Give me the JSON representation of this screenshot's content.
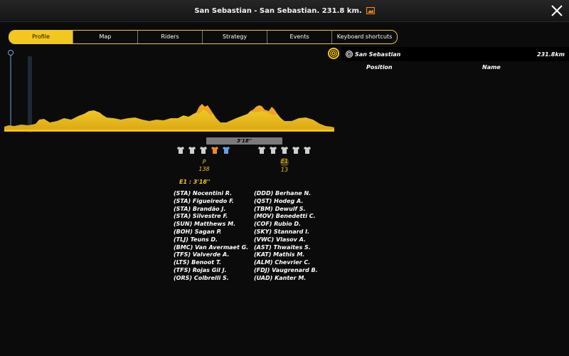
{
  "window": {
    "title": "San Sebastian - San Sebastian. 231.8 km."
  },
  "tabs": [
    {
      "label": "Profile",
      "active": true
    },
    {
      "label": "Map"
    },
    {
      "label": "Riders"
    },
    {
      "label": "Strategy"
    },
    {
      "label": "Events"
    },
    {
      "label": "Keyboard shortcuts"
    }
  ],
  "gap": {
    "bar_time": "3'18''",
    "summary": "E1 : 3'18''"
  },
  "peloton_group": {
    "label": "P",
    "count": "138"
  },
  "escape_group": {
    "label": "E1",
    "count": "13"
  },
  "jersey_groups": {
    "peloton": [
      "grey",
      "grey",
      "grey",
      "orange",
      "blue"
    ],
    "escape": [
      "grey",
      "grey",
      "grey",
      "grey",
      "grey"
    ]
  },
  "riders_left": [
    "(STA) Nocentini R.",
    "(STA) Figueiredo F.",
    "(STA) Brandão J.",
    "(STA) Silvestre F.",
    "(SUN) Matthews M.",
    "(BOH) Sagan P.",
    "(TLJ) Teuns D.",
    "(BMC) Van Avermaet G.",
    "(TFS) Valverde A.",
    "(LTS) Benoot T.",
    "(TFS) Rojas Gil J.",
    "(ORS) Colbrelli S."
  ],
  "riders_right": [
    "(DDD) Berhane N.",
    "(QST) Hodeg A.",
    "(TBM) Dewulf S.",
    "(MOV) Benedetti C.",
    "(COF) Rubio D.",
    "(SKY) Stannard I.",
    "(VWC) Vlasov A.",
    "(AST) Thwaites S.",
    "(KAT) Mathis M.",
    "(ALM) Chevrier C.",
    "(FDJ) Vaugrenard B.",
    "(UAD) Kanter M."
  ],
  "right_panel": {
    "race_name": "San Sebastian",
    "distance": "231.8km",
    "col_position": "Position",
    "col_name": "Name"
  },
  "colors": {
    "accent": "#f3c71d",
    "profile_fill": "#e5b71a",
    "background": "#0b0b0b"
  }
}
